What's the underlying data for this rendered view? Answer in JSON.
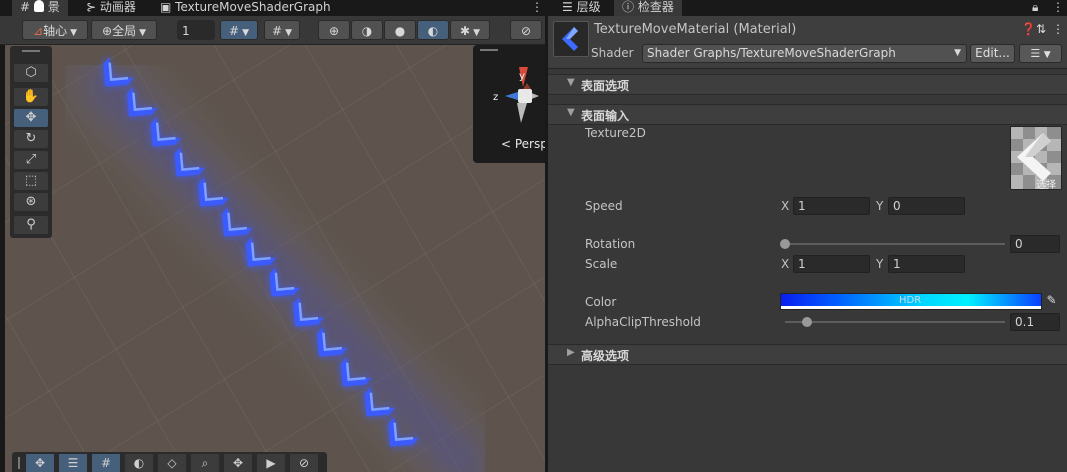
{
  "scene": {
    "tabs": [
      {
        "label": "景",
        "icon": "hash-icon"
      },
      {
        "label": "动画器",
        "icon": "animator-icon"
      },
      {
        "label": "TextureMoveShaderGraph",
        "icon": "graph-icon"
      }
    ],
    "toolbar": {
      "pivot_label": "轴心",
      "global_label": "全局",
      "grid_value": "1"
    },
    "gizmo": {
      "axis_y": "y",
      "axis_z": "z",
      "mode_label": "< Persp"
    },
    "colors": {
      "glow": "#3c5bff",
      "arrow": "#7ea0ff",
      "accent": "#46607c"
    }
  },
  "inspector": {
    "tabs": [
      {
        "label": "层级",
        "icon": "list-icon"
      },
      {
        "label": "检查器",
        "icon": "info-icon"
      }
    ],
    "material_title": "TextureMoveMaterial (Material)",
    "shader_label": "Shader",
    "shader_value": "Shader Graphs/TextureMoveShaderGraph",
    "edit_label": "Edit...",
    "sections": {
      "surface_options": "表面选项",
      "surface_inputs": "表面输入",
      "advanced_options": "高级选项"
    },
    "properties": {
      "texture_label": "Texture2D",
      "texture_select": "选择",
      "speed_label": "Speed",
      "speed_x_label": "X",
      "speed_x": "1",
      "speed_y_label": "Y",
      "speed_y": "0",
      "rotation_label": "Rotation",
      "rotation_value": "0",
      "rotation_fraction": 0,
      "scale_label": "Scale",
      "scale_x_label": "X",
      "scale_x": "1",
      "scale_y_label": "Y",
      "scale_y": "1",
      "color_label": "Color",
      "color_hdr": "HDR",
      "alpha_label": "AlphaClipThreshold",
      "alpha_value": "0.1",
      "alpha_fraction": 0.1
    }
  }
}
